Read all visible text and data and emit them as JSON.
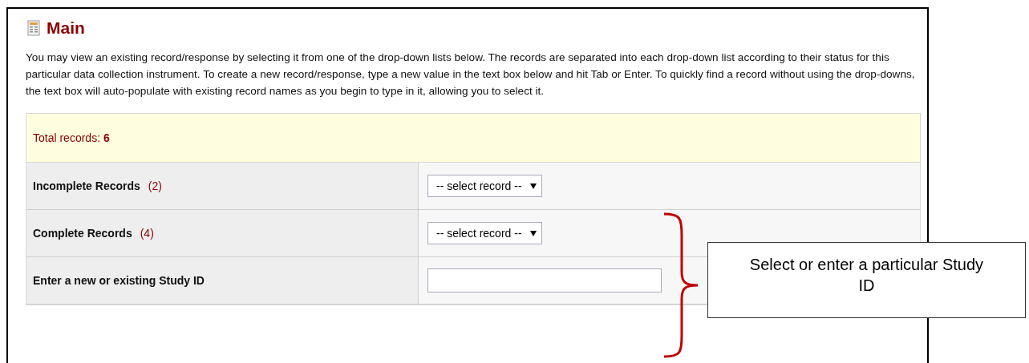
{
  "header": {
    "title": "Main"
  },
  "intro": "You may view an existing record/response by selecting it from one of the drop-down lists below. The records are separated into each drop-down list according to their status for this particular data collection instrument. To create a new record/response, type a new value in the text box below and hit Tab or Enter. To quickly find a record without using the drop-downs, the text box will auto-populate with existing record names as you begin to type in it, allowing you to select it.",
  "total": "Total records: **6**",
  "rows": [
    {
      "kind": "select",
      "label": "Incomplete Records",
      "count": "(2)",
      "value": "-- select record --"
    },
    {
      "kind": "select",
      "label": "Complete Records",
      "count": "(4)",
      "value": "-- select record --"
    },
    {
      "kind": "input",
      "label": "Enter a new or existing Study ID"
    }
  ],
  "callout": {
    "text": "Select or enter a particular Study ID"
  }
}
